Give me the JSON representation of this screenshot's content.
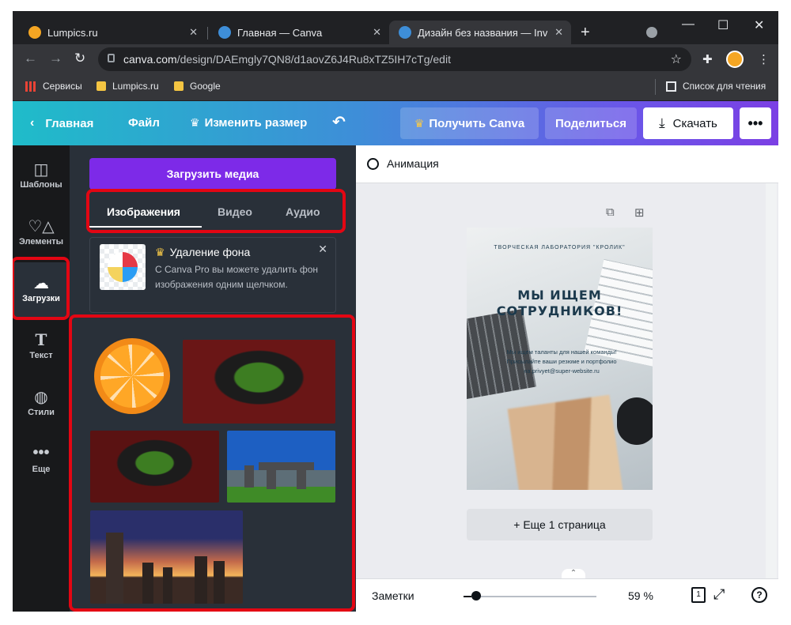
{
  "browser": {
    "tabs": [
      {
        "title": "Lumpics.ru",
        "favicon_color": "#f5a623",
        "active": false
      },
      {
        "title": "Главная — Canva",
        "favicon_color": "#3e8ed8",
        "active": false
      },
      {
        "title": "Дизайн без названия — Invitat",
        "favicon_color": "#3e8ed8",
        "active": true
      }
    ],
    "url_domain": "canva.com",
    "url_path": "/design/DAEmgly7QN8/d1aovZ6J4Ru8xTZ5IH7cTg/edit",
    "bookmarks": [
      {
        "label": "Сервисы",
        "icon": "apps-grid-icon"
      },
      {
        "label": "Lumpics.ru",
        "icon": "folder-icon"
      },
      {
        "label": "Google",
        "icon": "folder-icon"
      }
    ],
    "reading_list_label": "Список для чтения"
  },
  "header": {
    "home_label": "Главная",
    "file_label": "Файл",
    "resize_label": "Изменить размер",
    "get_pro_label": "Получить Canva",
    "share_label": "Поделиться",
    "download_label": "Скачать",
    "accent_color": "#7d2ae8"
  },
  "sidebar": {
    "items": [
      {
        "label": "Шаблоны",
        "icon": "templates-icon"
      },
      {
        "label": "Элементы",
        "icon": "elements-icon"
      },
      {
        "label": "Загрузки",
        "icon": "upload-cloud-icon",
        "active": true
      },
      {
        "label": "Текст",
        "icon": "text-icon"
      },
      {
        "label": "Стили",
        "icon": "palette-icon"
      },
      {
        "label": "Еще",
        "icon": "more-dots-icon"
      }
    ]
  },
  "panel": {
    "upload_button": "Загрузить медиа",
    "tabs": [
      {
        "label": "Изображения",
        "active": true
      },
      {
        "label": "Видео",
        "active": false
      },
      {
        "label": "Аудио",
        "active": false
      }
    ],
    "promo": {
      "title": "Удаление фона",
      "text": "С Canva Pro вы можете удалить фон изображения одним щелчком."
    }
  },
  "editor": {
    "animation_label": "Анимация",
    "design": {
      "top_line": "ТВОРЧЕСКАЯ ЛАБОРАТОРИЯ \"КРОЛИК\"",
      "title": "МЫ ИЩЕМ СОТРУДНИКОВ!",
      "body": "Мы ищем таланты для нашей команды! Присылайте ваши резюме и портфолио на privyet@super-website.ru"
    },
    "add_page_label": "+ Еще 1 страница",
    "notes_label": "Заметки",
    "zoom": "59 %",
    "page_count": "1",
    "help_glyph": "?"
  }
}
